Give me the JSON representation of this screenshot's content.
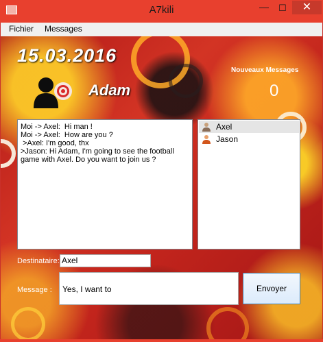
{
  "window": {
    "title": "A7kili",
    "minimize_glyph": "—",
    "maximize_glyph": "☐",
    "close_glyph": "✕"
  },
  "menu": {
    "items": [
      "Fichier",
      "Messages"
    ]
  },
  "header": {
    "date": "15.03.2016",
    "username": "Adam",
    "new_messages_label": "Nouveaux Messages",
    "new_messages_count": "0"
  },
  "chat": {
    "lines": [
      "Moi -> Axel:  Hi man !",
      "Moi -> Axel:  How are you ?",
      " >Axel: I'm good, thx",
      "",
      ">Jason: Hi Adam, I'm going to see the football game with Axel. Do you want to join us ?"
    ]
  },
  "contacts": [
    {
      "name": "Axel",
      "icon": "user-icon",
      "selected": true
    },
    {
      "name": "Jason",
      "icon": "user-icon",
      "selected": false
    }
  ],
  "form": {
    "recipient_label": "Destinataire:",
    "recipient_value": "Axel",
    "message_label": "Message   :",
    "message_value": "Yes, I want to",
    "send_label": "Envoyer"
  },
  "colors": {
    "titlebar": "#e8402e",
    "close_button": "#c7392b",
    "background": "#c9302a"
  }
}
